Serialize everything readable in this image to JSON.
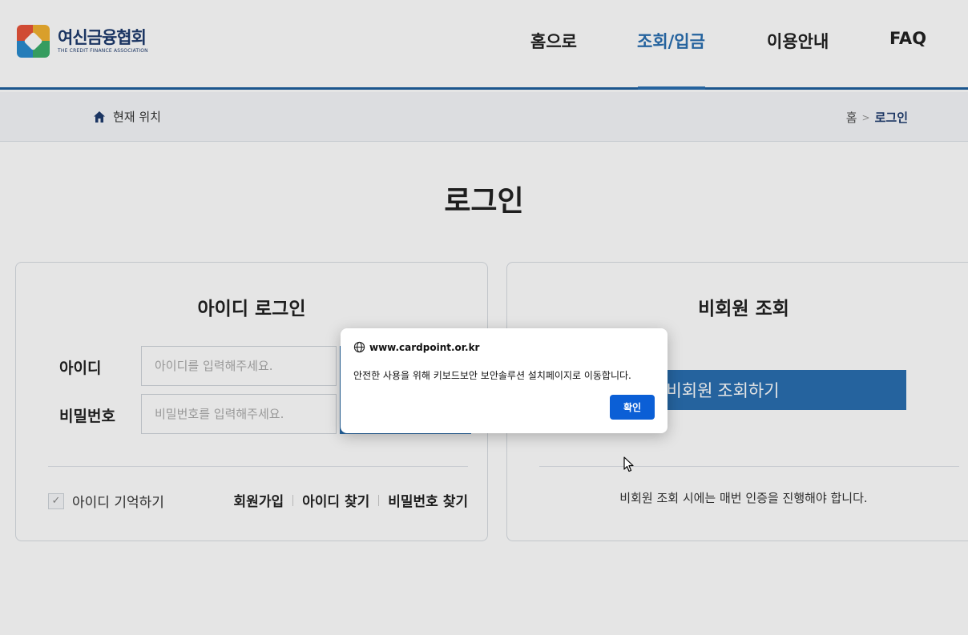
{
  "header": {
    "logo_kr": "여신금융협회",
    "logo_en": "THE CREDIT FINANCE ASSOCIATION",
    "nav": [
      {
        "label": "홈으로",
        "active": false
      },
      {
        "label": "조회/입금",
        "active": true
      },
      {
        "label": "이용안내",
        "active": false
      },
      {
        "label": "FAQ",
        "active": false
      }
    ]
  },
  "breadcrumb": {
    "location_label": "현재 위치",
    "home": "홈",
    "separator": ">",
    "current": "로그인"
  },
  "page": {
    "title": "로그인"
  },
  "login_card": {
    "title": "아이디 로그인",
    "id_label": "아이디",
    "id_placeholder": "아이디를 입력해주세요.",
    "pw_label": "비밀번호",
    "pw_placeholder": "비밀번호를 입력해주세요.",
    "remember_label": "아이디 기억하기",
    "remember_checked": true,
    "links": [
      "회원가입",
      "아이디 찾기",
      "비밀번호 찾기"
    ]
  },
  "guest_card": {
    "title": "비회원 조회",
    "button_label": "비회원 조회하기",
    "note": "비회원 조회 시에는 매번 인증을 진행해야 합니다."
  },
  "dialog": {
    "origin": "www.cardpoint.or.kr",
    "message": "안전한 사용을 위해 키보드보안 보안솔루션 설치페이지로 이동합니다.",
    "ok_label": "확인"
  },
  "colors": {
    "brand_blue": "#2a6fb0",
    "dialog_button": "#0b5fd6",
    "navy": "#1f3b6e"
  }
}
